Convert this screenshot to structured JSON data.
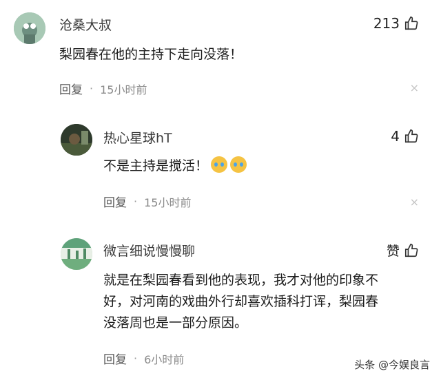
{
  "comments": [
    {
      "username": "沧桑大叔",
      "likes": "213",
      "text": "梨园春在他的主持下走向没落！",
      "reply_label": "回复",
      "time": "15小时前",
      "avatar_color": "#8db5a3"
    },
    {
      "username": "热心星球hT",
      "likes": "4",
      "text": "不是主持是搅活！",
      "emoji_icon": "crying-face-icon",
      "reply_label": "回复",
      "time": "15小时前",
      "avatar_color": "#3b4a3a"
    },
    {
      "username": "微言细说慢慢聊",
      "likes": "赞",
      "text_lines": [
        "就是在梨园春看到他的表现，我才对他的印象不",
        "好，对河南的戏曲外行却喜欢插科打诨，梨园春",
        "没落周也是一部分原因。"
      ],
      "reply_label": "回复",
      "time": "6小时前",
      "avatar_color": "#7fb08a"
    }
  ],
  "close_glyph": "×",
  "dot_glyph": "·",
  "watermark": "头条 @今娱良言"
}
